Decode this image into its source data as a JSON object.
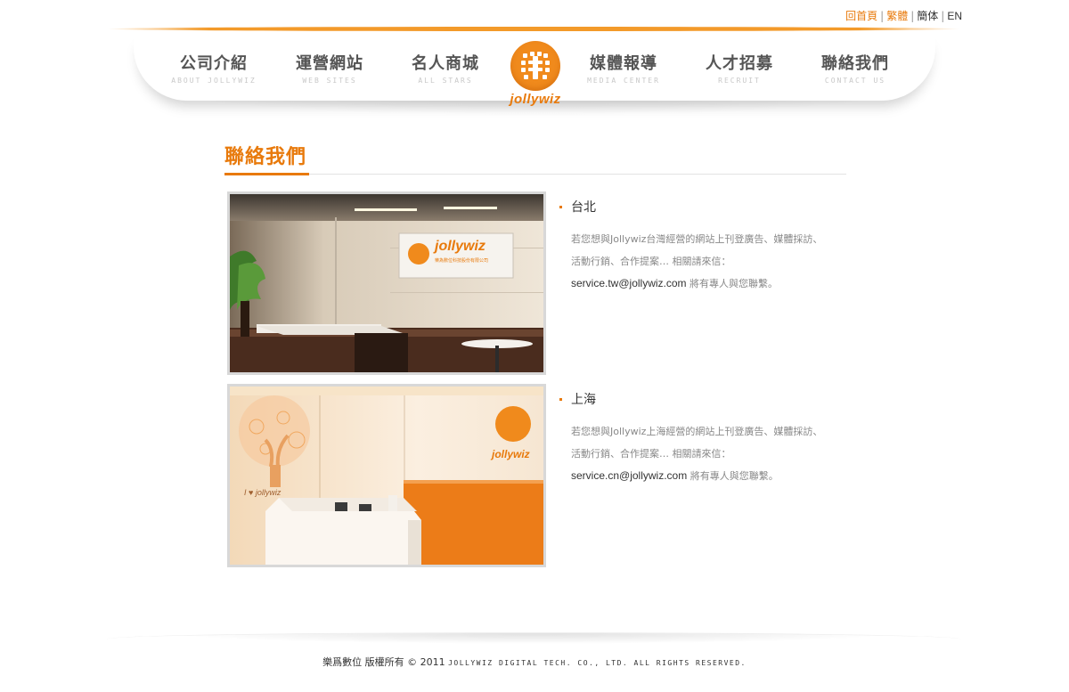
{
  "lang": {
    "home": "回首頁",
    "traditional": "繁體",
    "simplified": "簡体",
    "english": "EN"
  },
  "nav": {
    "items": [
      {
        "zh": "公司介紹",
        "en": "ABOUT JOLLYWIZ"
      },
      {
        "zh": "運營網站",
        "en": "WEB SITES"
      },
      {
        "zh": "名人商城",
        "en": "ALL STARS"
      },
      {
        "zh": "媒體報導",
        "en": "MEDIA CENTER"
      },
      {
        "zh": "人才招募",
        "en": "RECRUIT"
      },
      {
        "zh": "聯絡我們",
        "en": "CONTACT US"
      }
    ],
    "logo_word": "jollywiz"
  },
  "page": {
    "title": "聯絡我們"
  },
  "offices": [
    {
      "city": "台北",
      "text": "若您想與Jollywiz台灣經營的網站上刊登廣告、媒體採訪、活動行銷、合作提案… 相關請來信：",
      "email": "service.tw@jollywiz.com",
      "suffix": " 將有專人與您聯繫。",
      "sign_text": "jollywiz",
      "sign_sub": "樂為數位科技股份有限公司"
    },
    {
      "city": "上海",
      "text": "若您想與Jollywiz上海經營的網站上刊登廣告、媒體採訪、活動行銷、合作提案… 相關請來信：",
      "email": "service.cn@jollywiz.com",
      "suffix": " 將有專人與您聯繫。",
      "sign_text": "jollywiz",
      "wall_text": "I ♥ jollywiz"
    }
  ],
  "footer": {
    "zh": "樂爲數位 版權所有 © 2011",
    "en": "JOLLYWIZ DIGITAL TECH. CO., LTD. ALL RIGHTS RESERVED."
  },
  "colors": {
    "accent": "#e87a0c",
    "text": "#333333",
    "muted": "#888888"
  }
}
